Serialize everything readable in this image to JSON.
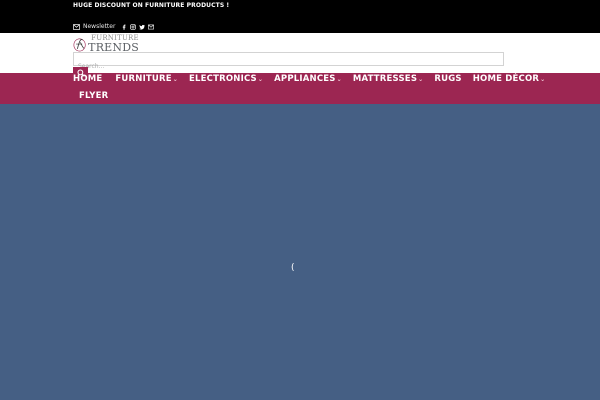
{
  "topbar": {
    "promo": "HUGE DISCOUNT ON FURNITURE PRODUCTS !",
    "newsletter_label": "Newsletter",
    "social_icons": [
      "facebook-icon",
      "instagram-icon",
      "twitter-icon",
      "email-icon"
    ]
  },
  "header": {
    "logo_top": "FURNITURE",
    "logo_bottom": "TRENDS",
    "search_placeholder": "Search..."
  },
  "nav": {
    "items": [
      {
        "label": "HOME",
        "has_dropdown": false
      },
      {
        "label": "FURNITURE",
        "has_dropdown": true
      },
      {
        "label": "ELECTRONICS",
        "has_dropdown": true
      },
      {
        "label": "APPLIANCES",
        "has_dropdown": true
      },
      {
        "label": "MATTRESSES",
        "has_dropdown": true
      },
      {
        "label": "RUGS",
        "has_dropdown": false
      },
      {
        "label": "HOME DÉCOR",
        "has_dropdown": true
      }
    ],
    "row2_label": "FLYER",
    "caret": "⌄"
  },
  "main": {
    "loader_glyph": "("
  },
  "colors": {
    "topbar_bg": "#000000",
    "brand_nav": "#9c2652",
    "main_bg": "#455f84"
  }
}
